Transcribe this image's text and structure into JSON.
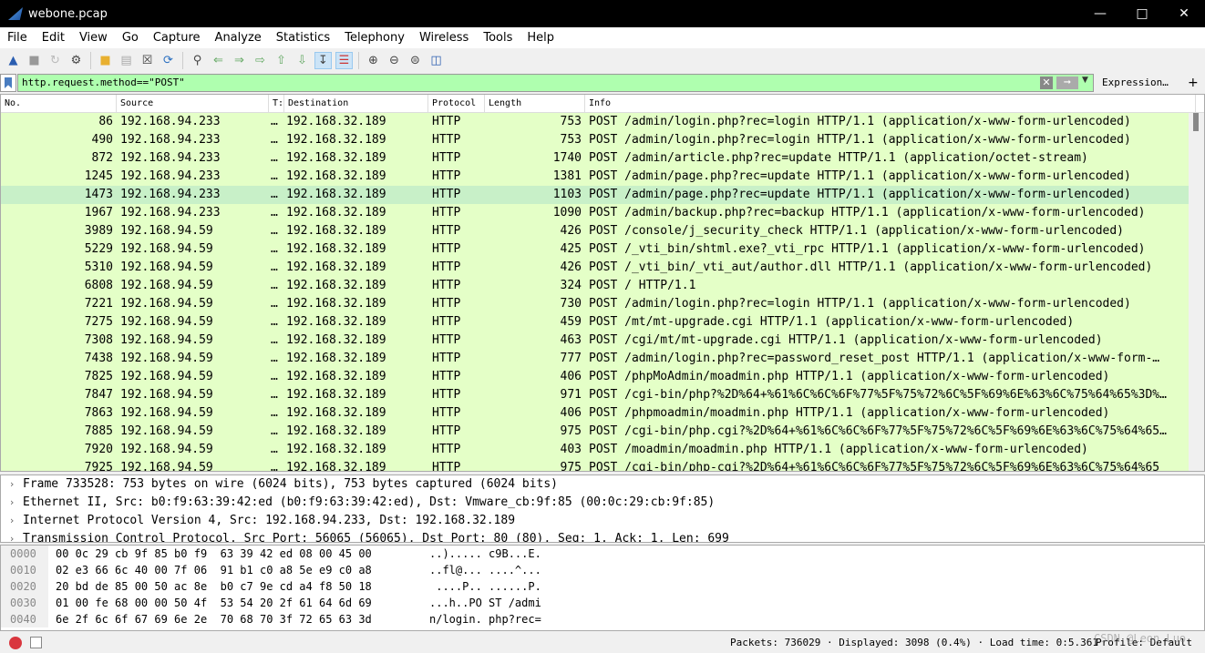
{
  "window": {
    "title": "webone.pcap"
  },
  "menu": [
    "File",
    "Edit",
    "View",
    "Go",
    "Capture",
    "Analyze",
    "Statistics",
    "Telephony",
    "Wireless",
    "Tools",
    "Help"
  ],
  "filter": {
    "value": "http.request.method==\"POST\"",
    "expression_label": "Expression…",
    "plus_label": "+"
  },
  "columns": [
    "No.",
    "Source",
    "T:",
    "Destination",
    "Protocol",
    "Length",
    "Info"
  ],
  "packets": [
    {
      "no": "86",
      "src": "192.168.94.233",
      "t": "…",
      "dst": "192.168.32.189",
      "proto": "HTTP",
      "len": "753",
      "info": "POST /admin/login.php?rec=login HTTP/1.1  (application/x-www-form-urlencoded)"
    },
    {
      "no": "490",
      "src": "192.168.94.233",
      "t": "…",
      "dst": "192.168.32.189",
      "proto": "HTTP",
      "len": "753",
      "info": "POST /admin/login.php?rec=login HTTP/1.1  (application/x-www-form-urlencoded)"
    },
    {
      "no": "872",
      "src": "192.168.94.233",
      "t": "…",
      "dst": "192.168.32.189",
      "proto": "HTTP",
      "len": "1740",
      "info": "POST /admin/article.php?rec=update HTTP/1.1  (application/octet-stream)"
    },
    {
      "no": "1245",
      "src": "192.168.94.233",
      "t": "…",
      "dst": "192.168.32.189",
      "proto": "HTTP",
      "len": "1381",
      "info": "POST /admin/page.php?rec=update HTTP/1.1  (application/x-www-form-urlencoded)"
    },
    {
      "no": "1473",
      "src": "192.168.94.233",
      "t": "…",
      "dst": "192.168.32.189",
      "proto": "HTTP",
      "len": "1103",
      "info": "POST /admin/page.php?rec=update HTTP/1.1  (application/x-www-form-urlencoded)",
      "selected": true
    },
    {
      "no": "1967",
      "src": "192.168.94.233",
      "t": "…",
      "dst": "192.168.32.189",
      "proto": "HTTP",
      "len": "1090",
      "info": "POST /admin/backup.php?rec=backup HTTP/1.1  (application/x-www-form-urlencoded)"
    },
    {
      "no": "3989",
      "src": "192.168.94.59",
      "t": "…",
      "dst": "192.168.32.189",
      "proto": "HTTP",
      "len": "426",
      "info": "POST /console/j_security_check HTTP/1.1  (application/x-www-form-urlencoded)"
    },
    {
      "no": "5229",
      "src": "192.168.94.59",
      "t": "…",
      "dst": "192.168.32.189",
      "proto": "HTTP",
      "len": "425",
      "info": "POST /_vti_bin/shtml.exe?_vti_rpc HTTP/1.1  (application/x-www-form-urlencoded)"
    },
    {
      "no": "5310",
      "src": "192.168.94.59",
      "t": "…",
      "dst": "192.168.32.189",
      "proto": "HTTP",
      "len": "426",
      "info": "POST /_vti_bin/_vti_aut/author.dll HTTP/1.1  (application/x-www-form-urlencoded)"
    },
    {
      "no": "6808",
      "src": "192.168.94.59",
      "t": "…",
      "dst": "192.168.32.189",
      "proto": "HTTP",
      "len": "324",
      "info": "POST / HTTP/1.1"
    },
    {
      "no": "7221",
      "src": "192.168.94.59",
      "t": "…",
      "dst": "192.168.32.189",
      "proto": "HTTP",
      "len": "730",
      "info": "POST /admin/login.php?rec=login HTTP/1.1  (application/x-www-form-urlencoded)"
    },
    {
      "no": "7275",
      "src": "192.168.94.59",
      "t": "…",
      "dst": "192.168.32.189",
      "proto": "HTTP",
      "len": "459",
      "info": "POST /mt/mt-upgrade.cgi HTTP/1.1  (application/x-www-form-urlencoded)"
    },
    {
      "no": "7308",
      "src": "192.168.94.59",
      "t": "…",
      "dst": "192.168.32.189",
      "proto": "HTTP",
      "len": "463",
      "info": "POST /cgi/mt/mt-upgrade.cgi HTTP/1.1  (application/x-www-form-urlencoded)"
    },
    {
      "no": "7438",
      "src": "192.168.94.59",
      "t": "…",
      "dst": "192.168.32.189",
      "proto": "HTTP",
      "len": "777",
      "info": "POST /admin/login.php?rec=password_reset_post HTTP/1.1  (application/x-www-form-…"
    },
    {
      "no": "7825",
      "src": "192.168.94.59",
      "t": "…",
      "dst": "192.168.32.189",
      "proto": "HTTP",
      "len": "406",
      "info": "POST /phpMoAdmin/moadmin.php HTTP/1.1  (application/x-www-form-urlencoded)"
    },
    {
      "no": "7847",
      "src": "192.168.94.59",
      "t": "…",
      "dst": "192.168.32.189",
      "proto": "HTTP",
      "len": "971",
      "info": "POST /cgi-bin/php?%2D%64+%61%6C%6C%6F%77%5F%75%72%6C%5F%69%6E%63%6C%75%64%65%3D%…"
    },
    {
      "no": "7863",
      "src": "192.168.94.59",
      "t": "…",
      "dst": "192.168.32.189",
      "proto": "HTTP",
      "len": "406",
      "info": "POST /phpmoadmin/moadmin.php HTTP/1.1  (application/x-www-form-urlencoded)"
    },
    {
      "no": "7885",
      "src": "192.168.94.59",
      "t": "…",
      "dst": "192.168.32.189",
      "proto": "HTTP",
      "len": "975",
      "info": "POST /cgi-bin/php.cgi?%2D%64+%61%6C%6C%6F%77%5F%75%72%6C%5F%69%6E%63%6C%75%64%65…"
    },
    {
      "no": "7920",
      "src": "192.168.94.59",
      "t": "…",
      "dst": "192.168.32.189",
      "proto": "HTTP",
      "len": "403",
      "info": "POST /moadmin/moadmin.php HTTP/1.1  (application/x-www-form-urlencoded)"
    },
    {
      "no": "7925",
      "src": "192.168.94.59",
      "t": "…",
      "dst": "192.168.32.189",
      "proto": "HTTP",
      "len": "975",
      "info": "POST /cgi-bin/php-cgi?%2D%64+%61%6C%6C%6F%77%5F%75%72%6C%5F%69%6E%63%6C%75%64%65"
    }
  ],
  "details": [
    "Frame 733528: 753 bytes on wire (6024 bits), 753 bytes captured (6024 bits)",
    "Ethernet II, Src: b0:f9:63:39:42:ed (b0:f9:63:39:42:ed), Dst: Vmware_cb:9f:85 (00:0c:29:cb:9f:85)",
    "Internet Protocol Version 4, Src: 192.168.94.233, Dst: 192.168.32.189",
    "Transmission Control Protocol, Src Port: 56065 (56065), Dst Port: 80 (80), Seq: 1, Ack: 1, Len: 699"
  ],
  "hex": [
    {
      "off": "0000",
      "bytes": "00 0c 29 cb 9f 85 b0 f9  63 39 42 ed 08 00 45 00",
      "ascii": "..)..... c9B...E."
    },
    {
      "off": "0010",
      "bytes": "02 e3 66 6c 40 00 7f 06  91 b1 c0 a8 5e e9 c0 a8",
      "ascii": "..fl@... ....^..."
    },
    {
      "off": "0020",
      "bytes": "20 bd de 85 00 50 ac 8e  b0 c7 9e cd a4 f8 50 18",
      "ascii": " ....P.. ......P."
    },
    {
      "off": "0030",
      "bytes": "01 00 fe 68 00 00 50 4f  53 54 20 2f 61 64 6d 69",
      "ascii": "...h..PO ST /admi"
    },
    {
      "off": "0040",
      "bytes": "6e 2f 6c 6f 67 69 6e 2e  70 68 70 3f 72 65 63 3d",
      "ascii": "n/login. php?rec="
    }
  ],
  "status": {
    "packets": "Packets: 736029 · Displayed: 3098 (0.4%) ·  Load time: 0:5.361",
    "profile": "Profile: Default",
    "watermark": "CSDN @Leon Luo"
  },
  "colors": {
    "http_row": "#e4ffc7",
    "filter_valid": "#afffaf",
    "titlebar": "#000000"
  }
}
